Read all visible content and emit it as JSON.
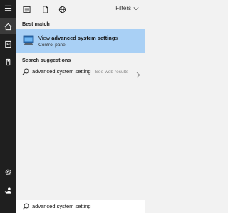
{
  "rail": {
    "icons": [
      "menu-icon",
      "home-icon",
      "notebook-icon",
      "device-icon",
      "settings-icon",
      "feedback-icon"
    ]
  },
  "toolbar": {
    "icons": [
      "apps-icon",
      "documents-icon",
      "web-icon"
    ],
    "filters_label": "Filters"
  },
  "best_match": {
    "heading": "Best match",
    "item": {
      "title_prefix": "View ",
      "title_bold": "advanced system setting",
      "title_suffix": "s",
      "subtitle": "Control panel",
      "icon": "control-panel-icon"
    }
  },
  "suggestions": {
    "heading": "Search suggestions",
    "items": [
      {
        "text": "advanced system setting",
        "meta": " - See web results"
      }
    ]
  },
  "search": {
    "value": "advanced system setting"
  },
  "colors": {
    "rail_bg": "#1f1f1f",
    "panel_bg": "#f2f2f2",
    "selected_bg": "#a9d0f5"
  }
}
